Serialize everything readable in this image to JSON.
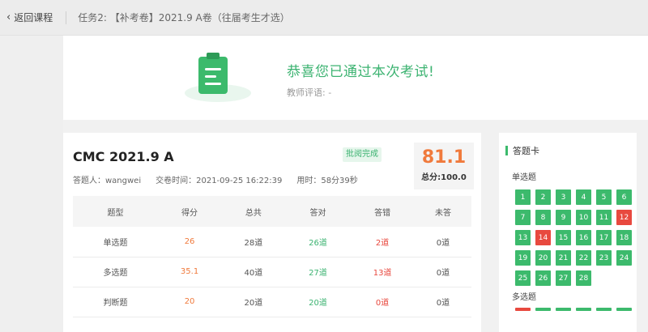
{
  "header": {
    "back_label": "返回课程",
    "task_title": "任务2: 【补考卷】2021.9 A卷（往届考生才选）"
  },
  "banner": {
    "title": "恭喜您已通过本次考试!",
    "teacher_comment": "教师评语: -"
  },
  "exam": {
    "title": "CMC 2021.9 A",
    "status": "批阅完成",
    "answerer": "答题人：wangwei",
    "submit_time": "交卷时间：2021-09-25 16:22:39",
    "duration": "用时：58分39秒",
    "score": "81.1",
    "total": "总分:100.0"
  },
  "table": {
    "headers": [
      "题型",
      "得分",
      "总共",
      "答对",
      "答错",
      "未答"
    ],
    "rows": [
      [
        "单选题",
        "26",
        "28道",
        "26道",
        "2道",
        "0道"
      ],
      [
        "多选题",
        "35.1",
        "40道",
        "27道",
        "13道",
        "0道"
      ],
      [
        "判断题",
        "20",
        "20道",
        "20道",
        "0道",
        "0道"
      ]
    ]
  },
  "answer_card": {
    "title": "答题卡",
    "single_label": "单选题",
    "multi_label": "多选题",
    "single_questions": [
      {
        "n": "1",
        "status": "correct"
      },
      {
        "n": "2",
        "status": "correct"
      },
      {
        "n": "3",
        "status": "correct"
      },
      {
        "n": "4",
        "status": "correct"
      },
      {
        "n": "5",
        "status": "correct"
      },
      {
        "n": "6",
        "status": "correct"
      },
      {
        "n": "7",
        "status": "correct"
      },
      {
        "n": "8",
        "status": "correct"
      },
      {
        "n": "9",
        "status": "correct"
      },
      {
        "n": "10",
        "status": "correct"
      },
      {
        "n": "11",
        "status": "correct"
      },
      {
        "n": "12",
        "status": "wrong"
      },
      {
        "n": "13",
        "status": "correct"
      },
      {
        "n": "14",
        "status": "wrong"
      },
      {
        "n": "15",
        "status": "correct"
      },
      {
        "n": "16",
        "status": "correct"
      },
      {
        "n": "17",
        "status": "correct"
      },
      {
        "n": "18",
        "status": "correct"
      },
      {
        "n": "19",
        "status": "correct"
      },
      {
        "n": "20",
        "status": "correct"
      },
      {
        "n": "21",
        "status": "correct"
      },
      {
        "n": "22",
        "status": "correct"
      },
      {
        "n": "23",
        "status": "correct"
      },
      {
        "n": "24",
        "status": "correct"
      },
      {
        "n": "25",
        "status": "correct"
      },
      {
        "n": "26",
        "status": "correct"
      },
      {
        "n": "27",
        "status": "correct"
      },
      {
        "n": "28",
        "status": "correct"
      }
    ],
    "multi_first_row_status": [
      "wrong",
      "correct",
      "correct",
      "correct",
      "correct",
      "correct"
    ]
  },
  "colors": {
    "green": "#3cba6c",
    "red": "#e8493f",
    "orange": "#f07a3c"
  }
}
